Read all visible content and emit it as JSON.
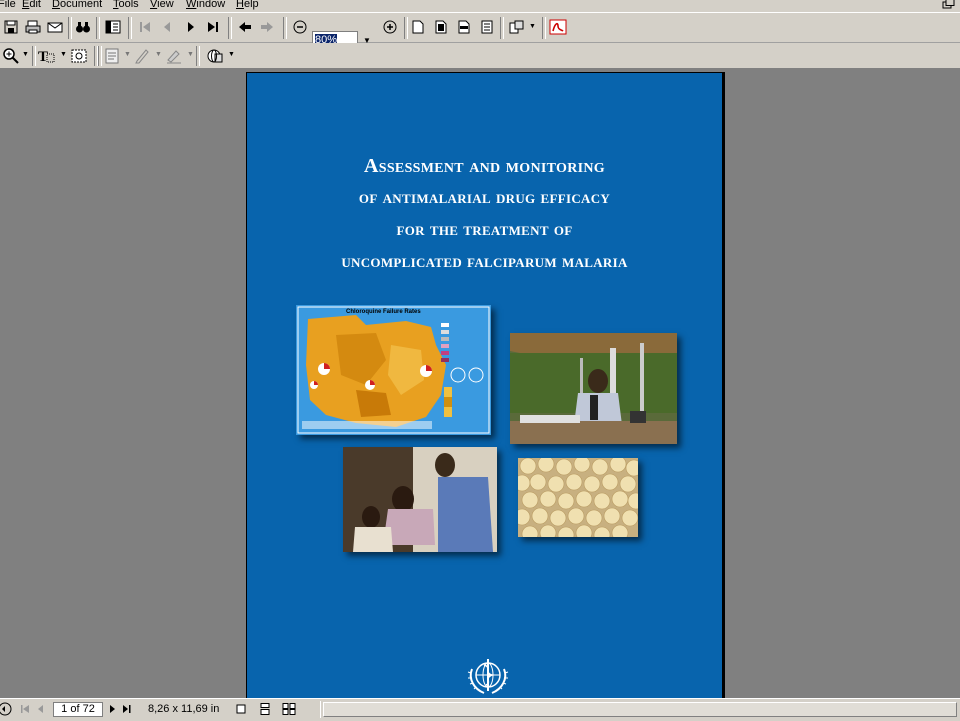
{
  "menubar": {
    "items": [
      {
        "label": "File",
        "u": ""
      },
      {
        "label": "Edit",
        "u": "E"
      },
      {
        "label": "Document",
        "u": "D"
      },
      {
        "label": "Tools",
        "u": "T"
      },
      {
        "label": "View",
        "u": "V"
      },
      {
        "label": "Window",
        "u": "W"
      },
      {
        "label": "Help",
        "u": "H"
      }
    ]
  },
  "toolbar": {
    "zoom_value": "80%"
  },
  "document": {
    "title_lines": [
      "Assessment and monitoring",
      "of antimalarial drug efficacy",
      "for the treatment of",
      "uncomplicated falciparum malaria"
    ],
    "map_caption": "Chloroquine Failure Rates",
    "colors": {
      "cover_blue": "#0864ad",
      "map_orange": "#e8a020"
    }
  },
  "statusbar": {
    "page_indicator": "1 of 72",
    "page_size": "8,26 x 11,69 in"
  }
}
